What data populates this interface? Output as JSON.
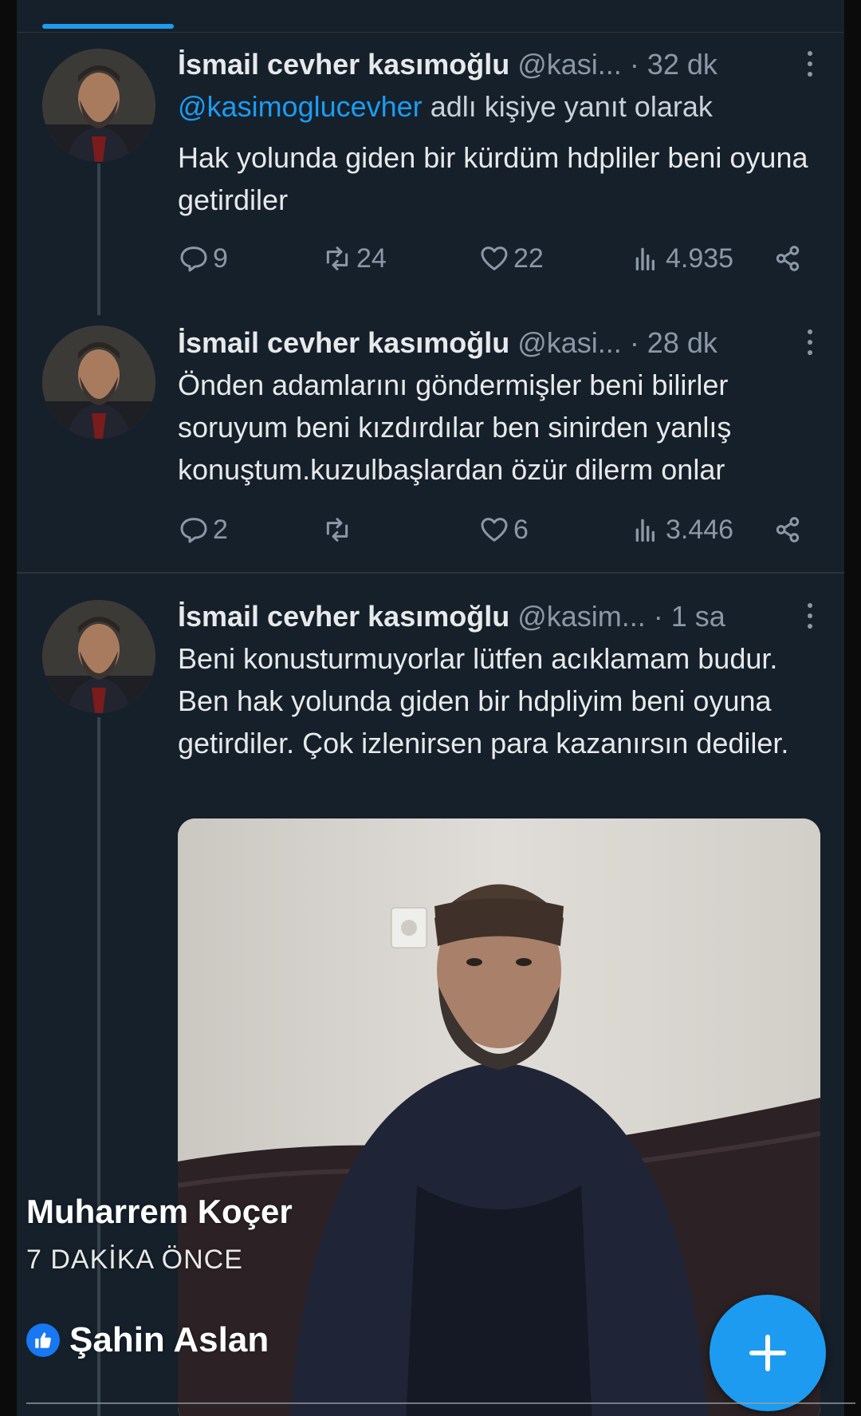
{
  "tweets": [
    {
      "name": "İsmail cevher kasımoğlu",
      "handle": "@kasi...",
      "time": "· 32 dk",
      "reply_mention": "@kasimoglucevher",
      "reply_suffix": "adlı kişiye yanıt olarak",
      "text": "Hak yolunda giden bir kürdüm hdpliler beni oyuna getirdiler",
      "replies": "9",
      "retweets": "24",
      "likes": "22",
      "views": "4.935"
    },
    {
      "name": "İsmail cevher kasımoğlu",
      "handle": "@kasi...",
      "time": "· 28 dk",
      "text": "Önden adamlarını göndermişler beni bilirler soruyum beni kızdırdılar ben sinirden yanlış konuştum.kuzulbaşlardan özür dilerm onlar",
      "replies": "2",
      "retweets": "",
      "likes": "6",
      "views": "3.446"
    },
    {
      "name": "İsmail cevher kasımoğlu",
      "handle": "@kasim...",
      "time": "· 1 sa",
      "text": "Beni konusturmuyorlar lütfen acıklamam budur. Ben hak yolunda giden bir hdpliyim beni oyuna getirdiler. Çok izlenirsen para kazanırsın dediler."
    }
  ],
  "overlay": {
    "author": "Muharrem Koçer",
    "time_ago": "7 DAKİKA ÖNCE",
    "liker": "Şahin Aslan"
  },
  "icons": {
    "reply": "reply-icon",
    "retweet": "retweet-icon",
    "like": "like-icon",
    "views": "views-icon",
    "share": "share-icon",
    "more": "more-icon",
    "compose": "plus-icon"
  },
  "colors": {
    "background": "#15202b",
    "accent": "#1d9bf0",
    "muted": "#8b98a5",
    "facebook_like": "#1877f2"
  }
}
